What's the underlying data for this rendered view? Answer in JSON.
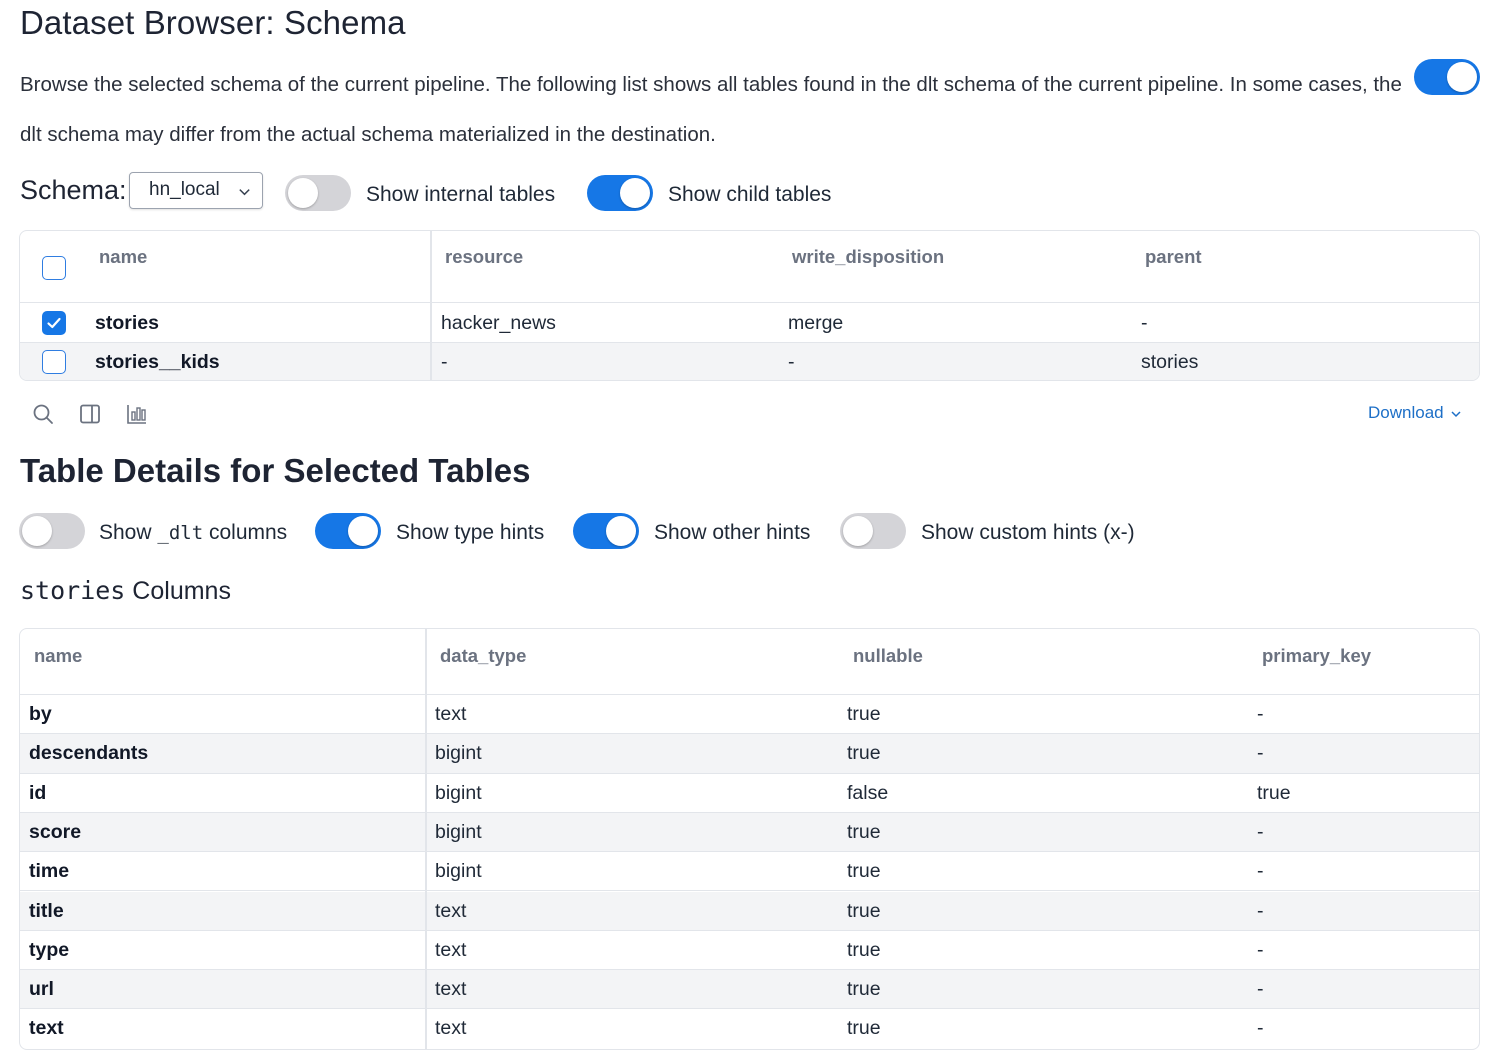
{
  "page": {
    "title": "Dataset Browser: Schema",
    "intro": "Browse the selected schema of the current pipeline. The following list shows all tables found in the dlt schema of the current pipeline. In some cases, the dlt schema may differ from the actual schema materialized in the destination.",
    "intro_toggle_on": true
  },
  "schema_controls": {
    "label": "Schema:",
    "selected": "hn_local",
    "show_internal_label": "Show internal tables",
    "show_internal_on": false,
    "show_child_label": "Show child tables",
    "show_child_on": true
  },
  "tables_table": {
    "headers": [
      "name",
      "resource",
      "write_disposition",
      "parent"
    ],
    "rows": [
      {
        "checked": true,
        "name": "stories",
        "resource": "hacker_news",
        "write_disposition": "merge",
        "parent": "-"
      },
      {
        "checked": false,
        "name": "stories__kids",
        "resource": "-",
        "write_disposition": "-",
        "parent": "stories"
      }
    ]
  },
  "toolbar": {
    "icons": [
      "search-icon",
      "panel-icon",
      "chart-icon"
    ],
    "download_label": "Download"
  },
  "details": {
    "title": "Table Details for Selected Tables",
    "toggles": [
      {
        "label_prefix": "Show ",
        "label_code": "_dlt",
        "label_suffix": " columns",
        "on": false
      },
      {
        "label": "Show type hints",
        "on": true
      },
      {
        "label": "Show other hints",
        "on": true
      },
      {
        "label": "Show custom hints (x-)",
        "on": false
      }
    ],
    "columns_title_code": "stories",
    "columns_title_suffix": " Columns"
  },
  "columns_table": {
    "headers": [
      "name",
      "data_type",
      "nullable",
      "primary_key"
    ],
    "rows": [
      {
        "name": "by",
        "data_type": "text",
        "nullable": "true",
        "primary_key": "-"
      },
      {
        "name": "descendants",
        "data_type": "bigint",
        "nullable": "true",
        "primary_key": "-"
      },
      {
        "name": "id",
        "data_type": "bigint",
        "nullable": "false",
        "primary_key": "true"
      },
      {
        "name": "score",
        "data_type": "bigint",
        "nullable": "true",
        "primary_key": "-"
      },
      {
        "name": "time",
        "data_type": "bigint",
        "nullable": "true",
        "primary_key": "-"
      },
      {
        "name": "title",
        "data_type": "text",
        "nullable": "true",
        "primary_key": "-"
      },
      {
        "name": "type",
        "data_type": "text",
        "nullable": "true",
        "primary_key": "-"
      },
      {
        "name": "url",
        "data_type": "text",
        "nullable": "true",
        "primary_key": "-"
      },
      {
        "name": "text",
        "data_type": "text",
        "nullable": "true",
        "primary_key": "-"
      }
    ]
  },
  "colors": {
    "accent": "#1677e6",
    "toggle_off": "#d4d4d8",
    "link": "#1d6fc7",
    "row_alt": "#f3f4f6"
  }
}
